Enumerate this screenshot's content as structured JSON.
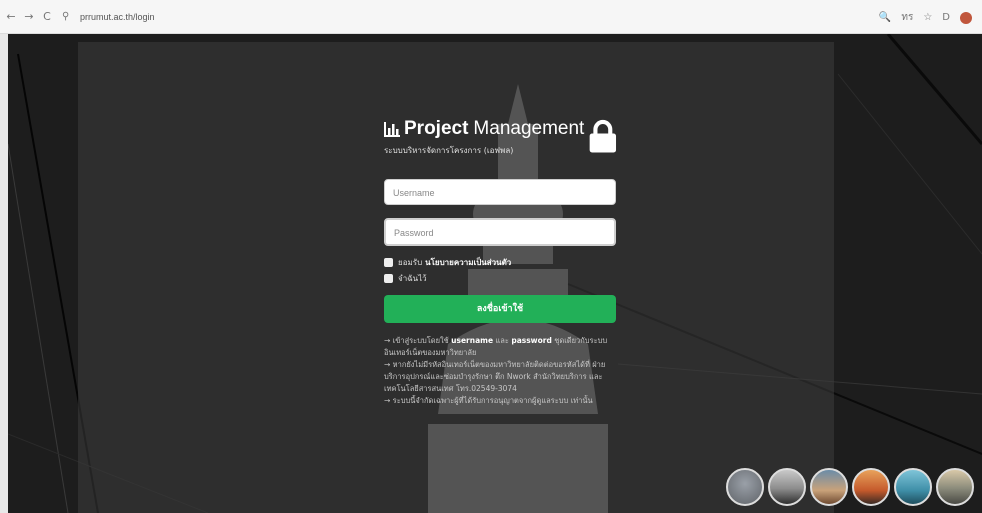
{
  "browser": {
    "back_icon": "←",
    "forward_icon": "→",
    "reload_icon": "C",
    "site_info_icon": "⚲",
    "url": "prrumut.ac.th/login",
    "zoom_icon": "🔍",
    "translate_icon": "ทร",
    "star_icon": "☆",
    "extension_icon": "D"
  },
  "login": {
    "title_bold": "Project",
    "title_rest": "Management",
    "subtitle": "ระบบบริหารจัดการโครงการ (เอฟพล)",
    "username_placeholder": "Username",
    "password_placeholder": "Password",
    "accept_text": "ยอมรับ",
    "policy_link": "นโยบายความเป็นส่วนตัว",
    "remember_text": "จำฉันไว้",
    "submit_label": "ลงชื่อเข้าใช้",
    "note1_pre": "→ เข้าสู่ระบบโดยใช้",
    "note1_user": "username",
    "note1_mid": "และ",
    "note1_pass": "password",
    "note1_post": "ชุดเดียวกับระบบ อินเทอร์เน็ตของมหาวิทยาลัย",
    "note2": "→ หากยังไม่มีรหัสอินเทอร์เน็ตของมหาวิทยาลัยติดต่อขอรหัสได้ที่ ฝ่ายบริการอุปกรณ์และซ่อมบำรุงรักษา ตึก Nwork สำนักวิทยบริการ และเทคโนโลยีสารสนเทศ โทร.02549-3074",
    "note3": "→ ระบบนี้จำกัดเฉพาะผู้ที่ได้รับการอนุญาตจากผู้ดูแลระบบ เท่านั้น"
  },
  "colors": {
    "button": "#22b058",
    "page_bg": "#1d1d1d"
  }
}
